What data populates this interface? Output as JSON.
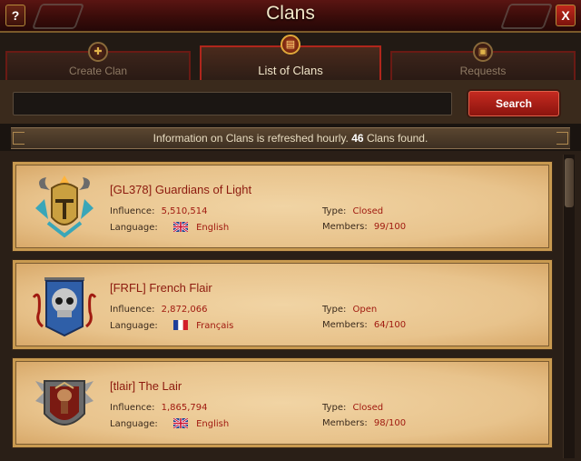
{
  "window": {
    "title": "Clans",
    "help_label": "?",
    "close_label": "X"
  },
  "tabs": [
    {
      "label": "Create Clan",
      "icon": "plus-shield-icon",
      "active": false
    },
    {
      "label": "List of Clans",
      "icon": "scroll-book-icon",
      "active": true
    },
    {
      "label": "Requests",
      "icon": "scroll-icon",
      "active": false
    }
  ],
  "search": {
    "value": "",
    "placeholder": "",
    "button_label": "Search"
  },
  "info": {
    "prefix": "Information on Clans is refreshed hourly.",
    "count": "46",
    "suffix": "Clans found."
  },
  "clans": [
    {
      "name": "[GL378] Guardians of Light",
      "influence_label": "Influence:",
      "influence": "5,510,514",
      "language_label": "Language:",
      "language": "English",
      "flag": "uk",
      "type_label": "Type:",
      "type": "Closed",
      "members_label": "Members:",
      "members": "99/100",
      "crest": "golden-helmet-crest-icon"
    },
    {
      "name": "[FRFL] French Flair",
      "influence_label": "Influence:",
      "influence": "2,872,066",
      "language_label": "Language:",
      "language": "Français",
      "flag": "france",
      "type_label": "Type:",
      "type": "Open",
      "members_label": "Members:",
      "members": "64/100",
      "crest": "skull-banner-crest-icon"
    },
    {
      "name": "[tlair] The Lair",
      "influence_label": "Influence:",
      "influence": "1,865,794",
      "language_label": "Language:",
      "language": "English",
      "flag": "uk",
      "type_label": "Type:",
      "type": "Closed",
      "members_label": "Members:",
      "members": "98/100",
      "crest": "horned-shield-crest-icon"
    }
  ],
  "colors": {
    "accent_red": "#b0261c",
    "value_red": "#a01a10",
    "parchment": "#e8c38c",
    "gold_border": "#c99a50"
  }
}
